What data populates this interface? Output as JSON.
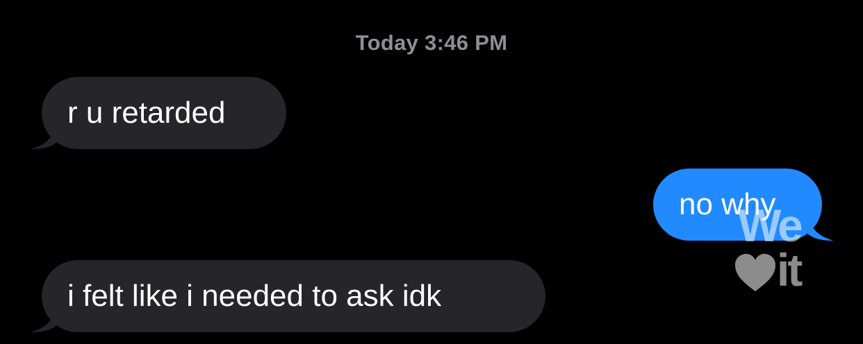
{
  "conversation": {
    "timestamp": "Today 3:46 PM",
    "messages": [
      {
        "direction": "incoming",
        "text": "r u retarded"
      },
      {
        "direction": "outgoing",
        "text": "no why"
      },
      {
        "direction": "incoming",
        "text": "i felt like i needed to ask idk"
      }
    ]
  },
  "watermark": {
    "top_text": "We",
    "bottom_text": "it",
    "icon": "heart-icon"
  },
  "colors": {
    "background": "#000000",
    "incoming_bubble": "#26252a",
    "outgoing_bubble": "#218aff",
    "timestamp_text": "#8e8e93",
    "message_text": "#ffffff"
  }
}
